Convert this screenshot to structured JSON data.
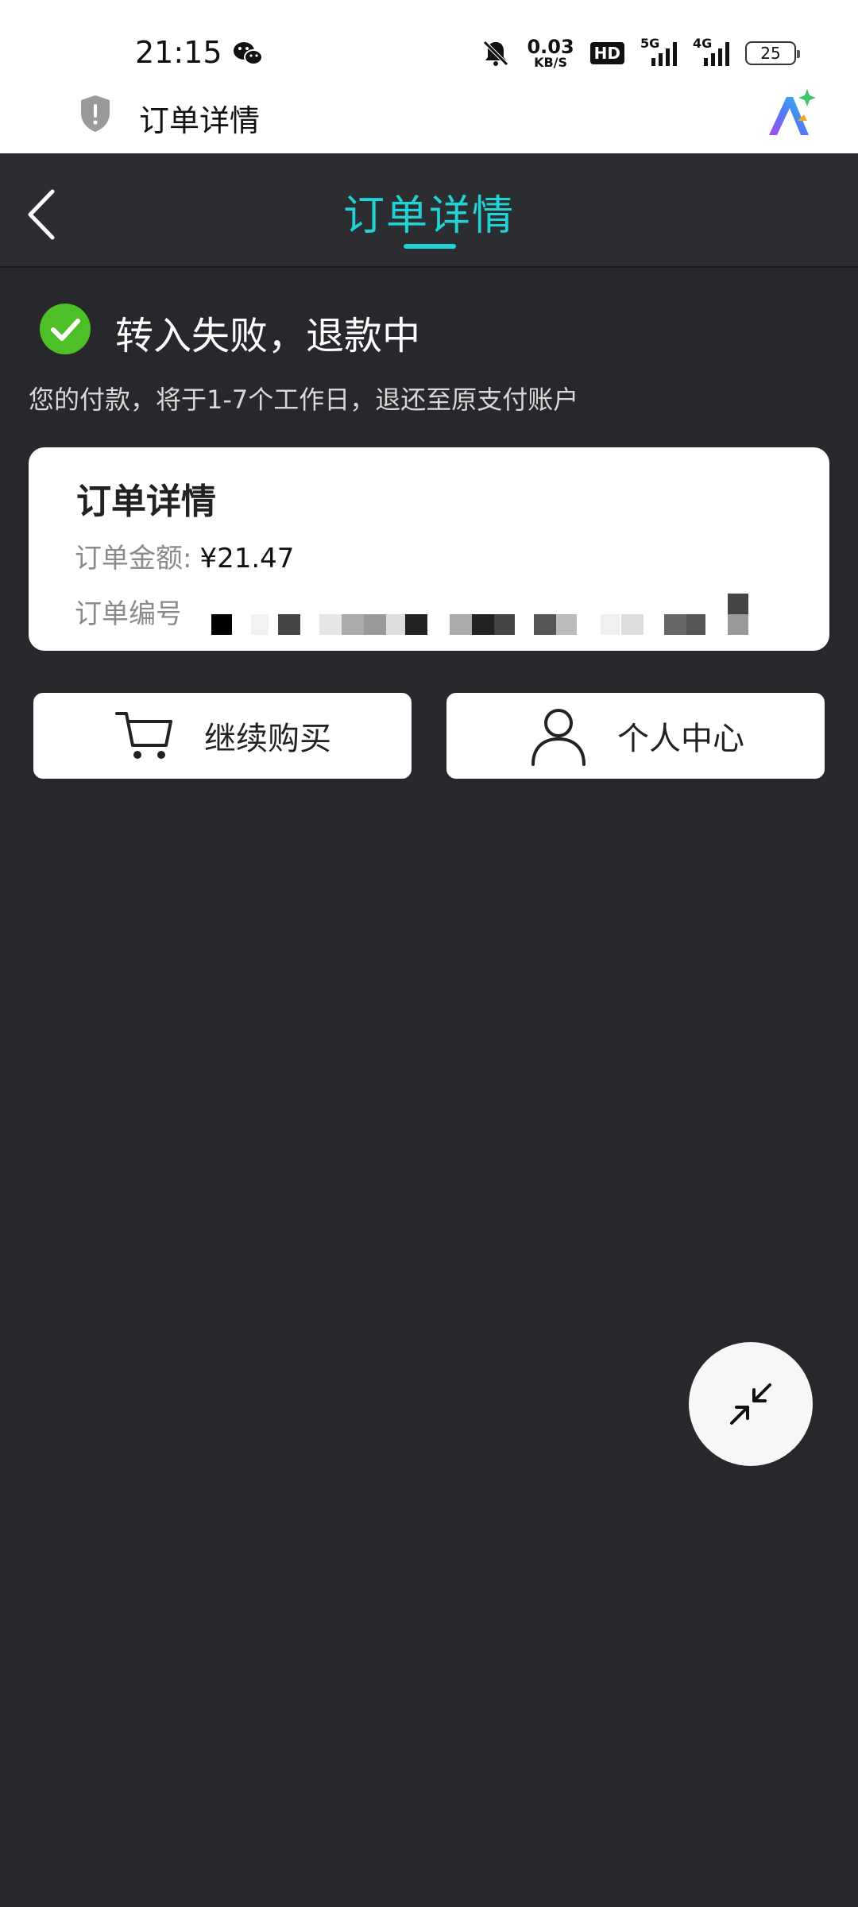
{
  "status_bar": {
    "time": "21:15",
    "net_speed": "0.03",
    "net_speed_unit": "KB/S",
    "hd_label": "HD",
    "network_5g": "5G",
    "network_4g": "4G",
    "battery": "25",
    "icons": [
      "wechat-icon",
      "bell-muted-icon",
      "signal-icon",
      "battery-icon"
    ]
  },
  "app_bar": {
    "title": "订单详情",
    "icons": [
      "shield-alert-icon",
      "ai-assistant-icon"
    ]
  },
  "nav": {
    "title": "订单详情",
    "accent_color": "#22d3d6"
  },
  "status": {
    "title": "转入失败，退款中",
    "subtitle": "您的付款，将于1-7个工作日，退还至原支付账户",
    "icon_color": "#4cc026"
  },
  "card": {
    "title": "订单详情",
    "amount_label": "订单金额:",
    "amount_value": "¥21.47",
    "number_label": "订单编号"
  },
  "buttons": {
    "continue_buy": "继续购买",
    "personal_center": "个人中心"
  },
  "colors": {
    "background": "#27282b",
    "navbar": "#2c2d31",
    "card": "#ffffff"
  }
}
